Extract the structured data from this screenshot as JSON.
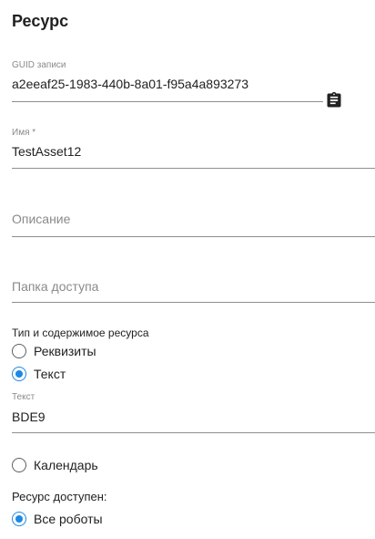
{
  "form": {
    "title": "Ресурс",
    "guid": {
      "label": "GUID записи",
      "value": "a2eeaf25-1983-440b-8a01-f95a4a893273",
      "copy_icon": "clipboard-icon"
    },
    "name": {
      "label": "Имя *",
      "value": "TestAsset12"
    },
    "description": {
      "placeholder": "Описание"
    },
    "access_folder": {
      "placeholder": "Папка доступа"
    },
    "resource_type": {
      "label": "Тип и содержимое ресурса",
      "options": [
        {
          "label": "Реквизиты",
          "checked": false
        },
        {
          "label": "Текст",
          "checked": true
        }
      ],
      "text_field": {
        "label": "Текст",
        "value": "BDE9"
      },
      "calendar_option": {
        "label": "Календарь",
        "checked": false
      }
    },
    "availability": {
      "label": "Ресурс доступен:",
      "option": {
        "label": "Все роботы",
        "checked": true
      }
    }
  },
  "colors": {
    "accent": "#1e88e5",
    "text": "#212121",
    "muted": "#8a8a8a",
    "line": "#8f8f8f"
  }
}
